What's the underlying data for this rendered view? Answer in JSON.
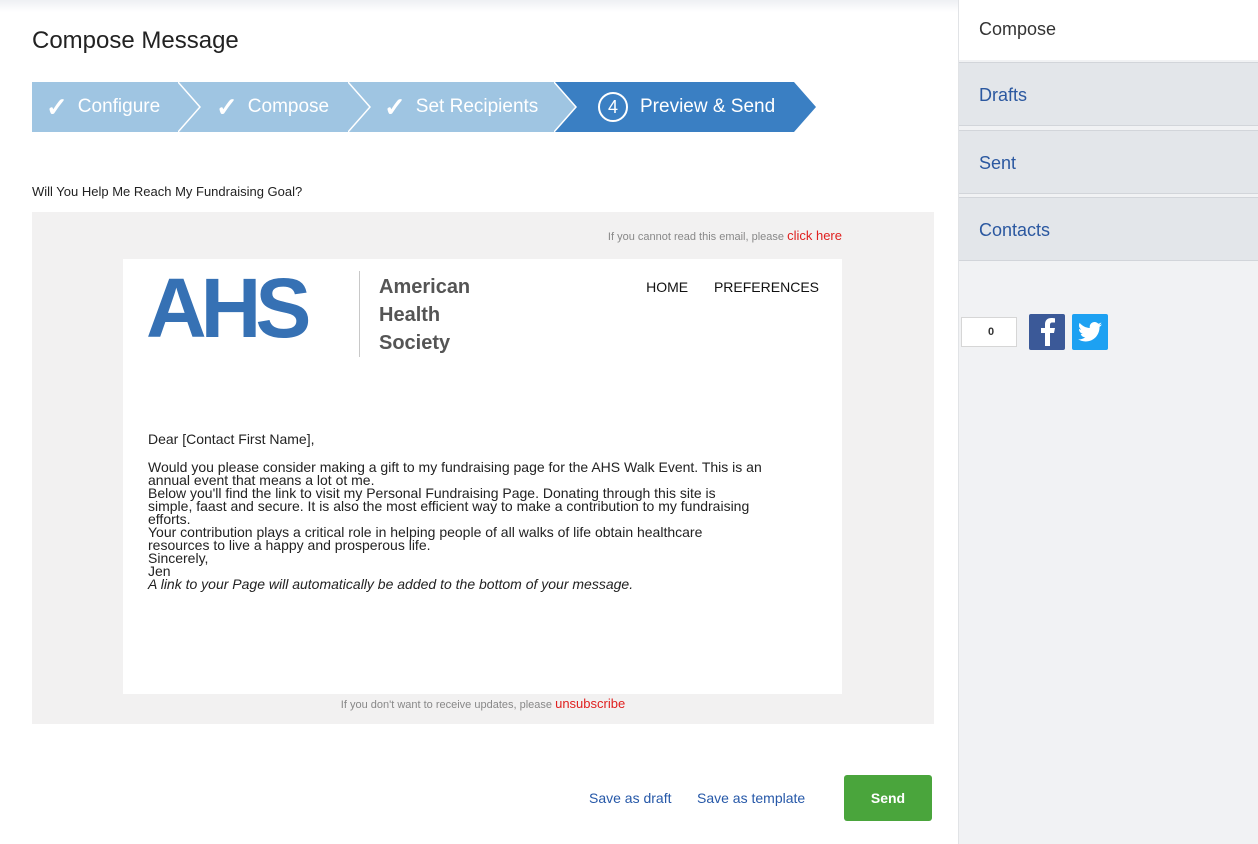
{
  "page": {
    "title": "Compose Message"
  },
  "steps": [
    {
      "label": "Configure",
      "status": "complete",
      "marker": "✓"
    },
    {
      "label": "Compose",
      "status": "complete",
      "marker": "✓"
    },
    {
      "label": "Set Recipients",
      "status": "complete",
      "marker": "✓"
    },
    {
      "label": "Preview & Send",
      "status": "active",
      "marker": "4"
    }
  ],
  "colors": {
    "step_complete": "#9fc5e2",
    "step_active": "#3a7fc3",
    "brand": "#3671b4",
    "send": "#4aa53c",
    "link": "#2658a8",
    "alert_link": "#e0201f"
  },
  "message": {
    "subject": "Will You Help Me Reach My Fundraising Goal?",
    "cant_read_text": "If you cannot read this email, please",
    "cant_read_link": "click here",
    "logo_mark": "AHS",
    "logo_lines": [
      "American",
      "Health",
      "Society"
    ],
    "nav": [
      "HOME",
      "PREFERENCES"
    ],
    "greeting": "Dear [Contact First Name],",
    "body_lines": [
      "Would you please consider making a gift to my fundraising page for the AHS Walk Event. This is an",
      "annual event that means a lot ot me.",
      "Below you'll find the link to visit my Personal Fundraising Page. Donating through this site is",
      "simple, faast and secure. It is also the most efficient way to make a contribution to my fundraising",
      "efforts.",
      "Your contribution plays a critical role in helping people of all walks of life obtain healthcare",
      "resources to live a happy and prosperous life.",
      "Sincerely,",
      "Jen"
    ],
    "note": "A link to your Page will automatically be added to the bottom of your message.",
    "unsubscribe_text": "If you don't want to receive updates, please",
    "unsubscribe_link": "unsubscribe"
  },
  "actions": {
    "save_draft": "Save as draft",
    "save_template": "Save as template",
    "send": "Send"
  },
  "sidebar": {
    "current": "Compose",
    "items": [
      {
        "label": "Drafts"
      },
      {
        "label": "Sent"
      },
      {
        "label": "Contacts"
      }
    ],
    "share_count": "0",
    "share_icons": [
      "facebook-icon",
      "twitter-icon"
    ]
  }
}
